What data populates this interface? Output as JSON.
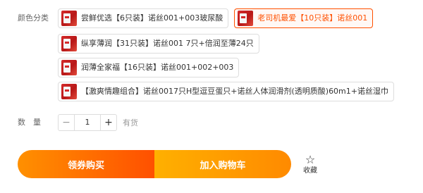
{
  "color_category": {
    "label": "颜色分类",
    "options": [
      {
        "text": "尝鲜优选【6只装】诺丝001+003玻尿酸",
        "selected": false
      },
      {
        "text": "老司机最爱【10只装】诺丝001",
        "selected": true
      },
      {
        "text": "纵享薄润【31只装】诺丝001 7只+倍润至薄24只",
        "selected": false
      },
      {
        "text": "润薄全家福【16只装】诺丝001+002+003",
        "selected": false
      },
      {
        "text": "【激爽情趣组合】诺丝0017只H型逗豆蛋只+诺丝人体润滑剂(透明质酸)60m1+诺丝湿巾",
        "selected": false
      }
    ]
  },
  "quantity": {
    "label": "数　量",
    "value": "1",
    "minus": "−",
    "plus": "+",
    "stock_text": "有货"
  },
  "actions": {
    "buy_label": "领券购买",
    "cart_label": "加入购物车",
    "favorite_label": "收藏",
    "favorite_icon": "☆"
  },
  "colors": {
    "accent": "#ff5000",
    "buy_gradient_start": "#ff9000",
    "cart_gradient_start": "#ffb000"
  }
}
